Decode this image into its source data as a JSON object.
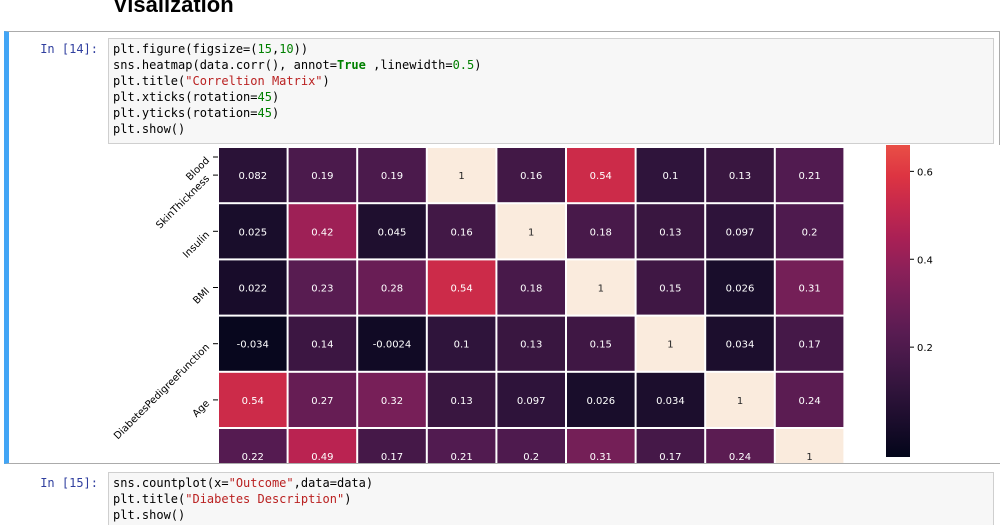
{
  "heading": "Visalization",
  "cell1": {
    "prompt": "In [14]:",
    "code": [
      [
        {
          "t": "plt.figure(figsize=("
        },
        {
          "t": "15",
          "c": "n"
        },
        {
          "t": ","
        },
        {
          "t": "10",
          "c": "n"
        },
        {
          "t": "))"
        }
      ],
      [
        {
          "t": "sns.heatmap(data.corr(), annot="
        },
        {
          "t": "True",
          "c": "k"
        },
        {
          "t": " ,linewidth="
        },
        {
          "t": "0.5",
          "c": "n"
        },
        {
          "t": ")"
        }
      ],
      [
        {
          "t": "plt.title("
        },
        {
          "t": "\"Correltion Matrix\"",
          "c": "s"
        },
        {
          "t": ")"
        }
      ],
      [
        {
          "t": "plt.xticks(rotation="
        },
        {
          "t": "45",
          "c": "n"
        },
        {
          "t": ")"
        }
      ],
      [
        {
          "t": "plt.yticks(rotation="
        },
        {
          "t": "45",
          "c": "n"
        },
        {
          "t": ")"
        }
      ],
      [
        {
          "t": "plt.show()"
        }
      ]
    ]
  },
  "cell2": {
    "prompt": "In [15]:",
    "code": [
      [
        {
          "t": "sns.countplot(x="
        },
        {
          "t": "\"Outcome\"",
          "c": "s"
        },
        {
          "t": ",data=data)"
        }
      ],
      [
        {
          "t": "plt.title("
        },
        {
          "t": "\"Diabetes Description\"",
          "c": "s"
        },
        {
          "t": ")"
        }
      ],
      [
        {
          "t": "plt.show()"
        }
      ]
    ]
  },
  "chart_data": {
    "type": "heatmap",
    "row_labels": [
      "Blood",
      "SkinThickness",
      "Insulin",
      "BMI",
      "DiabetesPedigreeFunction",
      "Age",
      ""
    ],
    "rows": [
      {
        "label": "SkinThickness",
        "values": [
          0.082,
          0.19,
          0.19,
          1,
          0.16,
          0.54,
          0.1,
          0.13,
          0.21
        ],
        "text": [
          "0.082",
          "0.19",
          "0.19",
          "1",
          "0.16",
          "0.54",
          "0.1",
          "0.13",
          "0.21"
        ]
      },
      {
        "label": "Insulin",
        "values": [
          0.025,
          0.42,
          0.045,
          0.16,
          1,
          0.18,
          0.13,
          0.097,
          0.2
        ],
        "text": [
          "0.025",
          "0.42",
          "0.045",
          "0.16",
          "1",
          "0.18",
          "0.13",
          "0.097",
          "0.2"
        ]
      },
      {
        "label": "BMI",
        "values": [
          0.022,
          0.23,
          0.28,
          0.54,
          0.18,
          1,
          0.15,
          0.026,
          0.31
        ],
        "text": [
          "0.022",
          "0.23",
          "0.28",
          "0.54",
          "0.18",
          "1",
          "0.15",
          "0.026",
          "0.31"
        ]
      },
      {
        "label": "DiabetesPedigreeFunction",
        "values": [
          -0.034,
          0.14,
          -0.0024,
          0.1,
          0.13,
          0.15,
          1,
          0.034,
          0.17
        ],
        "text": [
          "-0.034",
          "0.14",
          "-0.0024",
          "0.1",
          "0.13",
          "0.15",
          "1",
          "0.034",
          "0.17"
        ]
      },
      {
        "label": "Age",
        "values": [
          0.54,
          0.27,
          0.32,
          0.13,
          0.097,
          0.026,
          0.034,
          1,
          0.24
        ],
        "text": [
          "0.54",
          "0.27",
          "0.32",
          "0.13",
          "0.097",
          "0.026",
          "0.034",
          "1",
          "0.24"
        ]
      },
      {
        "label": "",
        "values": [
          0.22,
          0.49,
          0.17,
          0.21,
          0.2,
          0.31,
          0.17,
          0.24,
          1
        ],
        "text": [
          "0.22",
          "0.49",
          "0.17",
          "0.21",
          "0.2",
          "0.31",
          "0.17",
          "0.24",
          "1"
        ]
      }
    ],
    "colorbar": {
      "ticks": [
        0.6,
        0.4,
        0.2
      ],
      "tick_labels": [
        "0.6",
        "0.4",
        "0.2"
      ],
      "vmin": -0.05,
      "vmax": 1.0,
      "visible_max": 0.66
    },
    "colormap": "rocket"
  }
}
